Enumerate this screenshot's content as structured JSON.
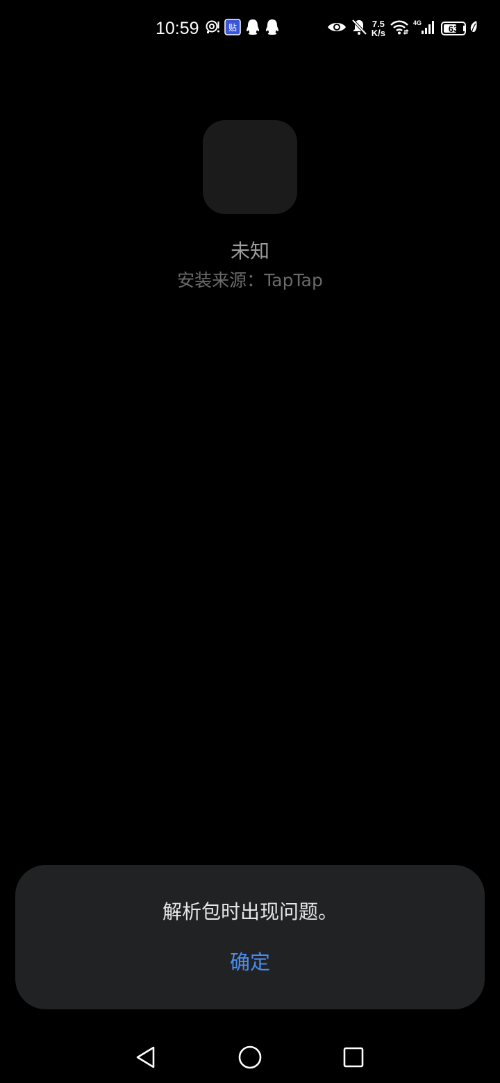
{
  "status_bar": {
    "time": "10:59",
    "net_speed_value": "7.5",
    "net_speed_unit": "K/s",
    "network_type": "4G",
    "battery_level": "63",
    "battery_fraction": 0.63,
    "left_icons": [
      "hotspot-icon",
      "tieba-app-icon",
      "qq-icon",
      "qq-icon"
    ],
    "right_icons": [
      "eye-icon",
      "bell-off-icon",
      "wifi-icon",
      "signal-icon",
      "battery-icon",
      "leaf-icon"
    ]
  },
  "app": {
    "name": "未知",
    "source": "安装来源：TapTap"
  },
  "dialog": {
    "message": "解析包时出现问题。",
    "confirm_label": "确定",
    "confirm_color": "#4a8cf0"
  },
  "nav_bar": {
    "buttons": [
      "back-icon",
      "home-icon",
      "recents-icon"
    ]
  }
}
